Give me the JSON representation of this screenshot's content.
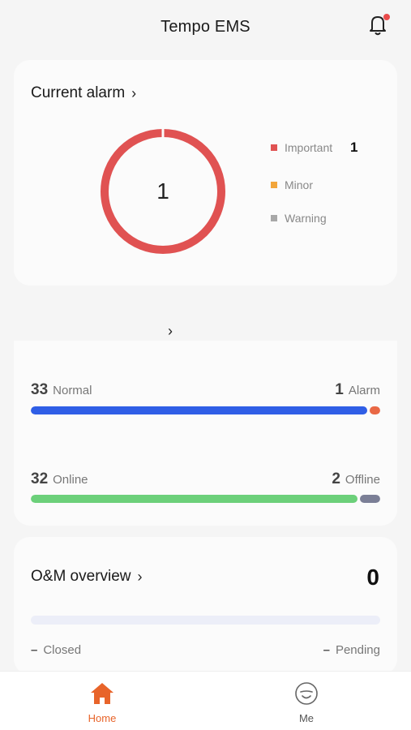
{
  "header": {
    "title": "Tempo EMS",
    "has_notification": true
  },
  "alarm": {
    "title": "Current alarm",
    "total": "1",
    "colors": {
      "important": "#e05252",
      "minor": "#f2a63b",
      "warning": "#a8a8a8"
    },
    "legend": [
      {
        "label": "Important",
        "count": "1",
        "color": "#e05252"
      },
      {
        "label": "Minor",
        "count": "",
        "color": "#f2a63b"
      },
      {
        "label": "Warning",
        "count": "",
        "color": "#a8a8a8"
      }
    ]
  },
  "status": {
    "health": {
      "left_num": "33",
      "left_label": "Normal",
      "right_num": "1",
      "right_label": "Alarm",
      "left_value": 33,
      "right_value": 1,
      "left_color": "#2f5ee6",
      "right_color": "#e96845"
    },
    "connection": {
      "left_num": "32",
      "left_label": "Online",
      "right_num": "2",
      "right_label": "Offline",
      "left_value": 32,
      "right_value": 2,
      "left_color": "#6cd07a",
      "right_color": "#7b7f96"
    }
  },
  "om": {
    "title": "O&M overview",
    "count": "0",
    "closed_label": "Closed",
    "pending_label": "Pending",
    "dash": "–"
  },
  "tabs": [
    {
      "label": "Home",
      "active": true,
      "icon": "home-icon",
      "color": "#e8642a"
    },
    {
      "label": "Me",
      "active": false,
      "icon": "face-icon",
      "color": "#555555"
    }
  ]
}
